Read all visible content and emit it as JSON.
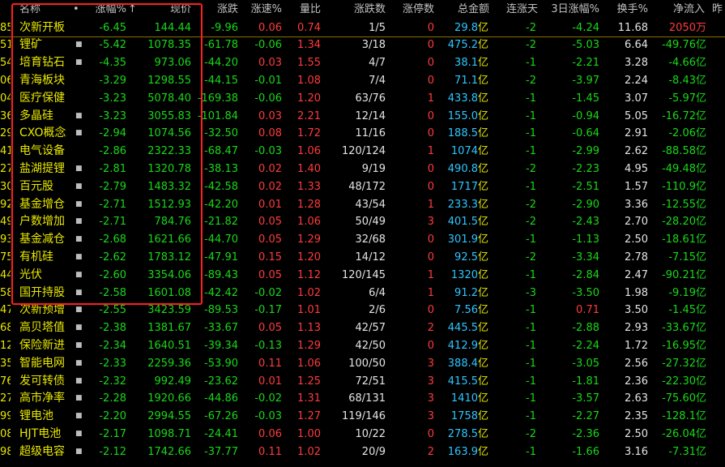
{
  "headers": {
    "name": "名称",
    "dot": "•",
    "change_pct": "涨幅%",
    "sort_arrow": "↑",
    "price": "现价",
    "change": "涨跌",
    "speed": "涨速%",
    "volume_ratio": "量比",
    "rise_fall": "涨跌数",
    "limit_up": "涨停数",
    "amount": "总金额",
    "streak": "连涨天",
    "three_day": "3日涨幅%",
    "turnover": "换手%",
    "net_inflow": "净流入",
    "extra": "昨"
  },
  "rows": [
    {
      "code": "85",
      "name": "次新开板",
      "mark": "",
      "change_pct": "-6.45",
      "price": "144.44",
      "change": "-9.96",
      "speed": "0.06",
      "volume_ratio": "0.74",
      "rise_fall": "1/5",
      "limit_up": "0",
      "amount": "29.8",
      "streak": "-2",
      "three_day": "-4.24",
      "turnover": "11.68",
      "net_inflow": "2050万"
    },
    {
      "code": "51",
      "name": "锂矿",
      "mark": "■",
      "change_pct": "-5.42",
      "price": "1078.35",
      "change": "-61.78",
      "speed": "-0.06",
      "volume_ratio": "1.34",
      "rise_fall": "3/18",
      "limit_up": "0",
      "amount": "475.2",
      "streak": "-2",
      "three_day": "-5.03",
      "turnover": "6.64",
      "net_inflow": "-49.76亿"
    },
    {
      "code": "54",
      "name": "培育钻石",
      "mark": "■",
      "change_pct": "-4.35",
      "price": "973.06",
      "change": "-44.20",
      "speed": "0.03",
      "volume_ratio": "1.55",
      "rise_fall": "4/7",
      "limit_up": "0",
      "amount": "38.1",
      "streak": "-1",
      "three_day": "-2.21",
      "turnover": "3.28",
      "net_inflow": "-4.66亿"
    },
    {
      "code": "06",
      "name": "青海板块",
      "mark": "",
      "change_pct": "-3.29",
      "price": "1298.55",
      "change": "-44.15",
      "speed": "-0.01",
      "volume_ratio": "1.08",
      "rise_fall": "7/4",
      "limit_up": "0",
      "amount": "71.1",
      "streak": "-2",
      "three_day": "-3.97",
      "turnover": "2.24",
      "net_inflow": "-8.43亿"
    },
    {
      "code": "04",
      "name": "医疗保健",
      "mark": "",
      "change_pct": "-3.23",
      "price": "5078.40",
      "change": "-169.38",
      "speed": "-0.06",
      "volume_ratio": "1.20",
      "rise_fall": "63/76",
      "limit_up": "1",
      "amount": "433.8",
      "streak": "-1",
      "three_day": "-1.45",
      "turnover": "3.07",
      "net_inflow": "-5.97亿"
    },
    {
      "code": "36",
      "name": "多晶硅",
      "mark": "■",
      "change_pct": "-3.23",
      "price": "3055.83",
      "change": "-101.84",
      "speed": "0.03",
      "volume_ratio": "2.21",
      "rise_fall": "12/14",
      "limit_up": "0",
      "amount": "155.0",
      "streak": "-1",
      "three_day": "-0.94",
      "turnover": "5.05",
      "net_inflow": "-16.72亿"
    },
    {
      "code": "29",
      "name": "CXO概念",
      "mark": "■",
      "change_pct": "-2.94",
      "price": "1074.56",
      "change": "-32.50",
      "speed": "0.08",
      "volume_ratio": "1.72",
      "rise_fall": "11/16",
      "limit_up": "0",
      "amount": "188.5",
      "streak": "-1",
      "three_day": "-0.64",
      "turnover": "2.91",
      "net_inflow": "-2.06亿"
    },
    {
      "code": "41",
      "name": "电气设备",
      "mark": "",
      "change_pct": "-2.86",
      "price": "2322.33",
      "change": "-68.47",
      "speed": "-0.03",
      "volume_ratio": "1.06",
      "rise_fall": "120/124",
      "limit_up": "1",
      "amount": "1074",
      "streak": "-1",
      "three_day": "-2.99",
      "turnover": "2.62",
      "net_inflow": "-88.58亿"
    },
    {
      "code": "27",
      "name": "盐湖提锂",
      "mark": "■",
      "change_pct": "-2.81",
      "price": "1320.78",
      "change": "-38.13",
      "speed": "0.02",
      "volume_ratio": "1.40",
      "rise_fall": "9/19",
      "limit_up": "0",
      "amount": "490.8",
      "streak": "-2",
      "three_day": "-2.23",
      "turnover": "4.95",
      "net_inflow": "-49.48亿"
    },
    {
      "code": "30",
      "name": "百元股",
      "mark": "■",
      "change_pct": "-2.79",
      "price": "1483.32",
      "change": "-42.58",
      "speed": "0.02",
      "volume_ratio": "1.33",
      "rise_fall": "48/172",
      "limit_up": "0",
      "amount": "1717",
      "streak": "-1",
      "three_day": "-2.51",
      "turnover": "1.57",
      "net_inflow": "-110.9亿"
    },
    {
      "code": "92",
      "name": "基金增仓",
      "mark": "■",
      "change_pct": "-2.71",
      "price": "1512.93",
      "change": "-42.20",
      "speed": "0.01",
      "volume_ratio": "1.28",
      "rise_fall": "43/54",
      "limit_up": "1",
      "amount": "233.3",
      "streak": "-2",
      "three_day": "-2.90",
      "turnover": "3.36",
      "net_inflow": "-12.55亿"
    },
    {
      "code": "49",
      "name": "户数增加",
      "mark": "■",
      "change_pct": "-2.71",
      "price": "784.76",
      "change": "-21.82",
      "speed": "0.05",
      "volume_ratio": "1.06",
      "rise_fall": "50/49",
      "limit_up": "3",
      "amount": "401.5",
      "streak": "-2",
      "three_day": "-2.43",
      "turnover": "2.70",
      "net_inflow": "-28.20亿"
    },
    {
      "code": "93",
      "name": "基金减仓",
      "mark": "■",
      "change_pct": "-2.68",
      "price": "1621.66",
      "change": "-44.70",
      "speed": "0.05",
      "volume_ratio": "1.29",
      "rise_fall": "32/68",
      "limit_up": "0",
      "amount": "301.9",
      "streak": "-1",
      "three_day": "-1.13",
      "turnover": "2.50",
      "net_inflow": "-18.61亿"
    },
    {
      "code": "75",
      "name": "有机硅",
      "mark": "■",
      "change_pct": "-2.62",
      "price": "1783.12",
      "change": "-47.91",
      "speed": "0.15",
      "volume_ratio": "1.20",
      "rise_fall": "14/12",
      "limit_up": "0",
      "amount": "92.5",
      "streak": "-2",
      "three_day": "-3.34",
      "turnover": "2.78",
      "net_inflow": "-7.15亿"
    },
    {
      "code": "44",
      "name": "光伏",
      "mark": "■",
      "change_pct": "-2.60",
      "price": "3354.06",
      "change": "-89.43",
      "speed": "0.05",
      "volume_ratio": "1.12",
      "rise_fall": "120/145",
      "limit_up": "1",
      "amount": "1320",
      "streak": "-1",
      "three_day": "-2.84",
      "turnover": "2.47",
      "net_inflow": "-90.21亿"
    },
    {
      "code": "58",
      "name": "国开持股",
      "mark": "■",
      "change_pct": "-2.58",
      "price": "1601.08",
      "change": "-42.42",
      "speed": "-0.02",
      "volume_ratio": "1.02",
      "rise_fall": "6/4",
      "limit_up": "1",
      "amount": "91.2",
      "streak": "-3",
      "three_day": "-3.50",
      "turnover": "1.98",
      "net_inflow": "-9.19亿"
    },
    {
      "code": "47",
      "name": "次新预增",
      "mark": "■",
      "change_pct": "-2.55",
      "price": "3423.59",
      "change": "-89.53",
      "speed": "-0.17",
      "volume_ratio": "1.01",
      "rise_fall": "2/6",
      "limit_up": "0",
      "amount": "7.56",
      "streak": "-1",
      "three_day": "0.71",
      "turnover": "3.50",
      "net_inflow": "-1.45亿"
    },
    {
      "code": "68",
      "name": "高贝塔值",
      "mark": "■",
      "change_pct": "-2.38",
      "price": "1381.67",
      "change": "-33.67",
      "speed": "0.05",
      "volume_ratio": "1.13",
      "rise_fall": "42/57",
      "limit_up": "2",
      "amount": "445.5",
      "streak": "-1",
      "three_day": "-2.88",
      "turnover": "2.93",
      "net_inflow": "-33.67亿"
    },
    {
      "code": "12",
      "name": "保险新进",
      "mark": "■",
      "change_pct": "-2.34",
      "price": "1640.51",
      "change": "-39.34",
      "speed": "-0.13",
      "volume_ratio": "1.29",
      "rise_fall": "42/50",
      "limit_up": "0",
      "amount": "412.9",
      "streak": "-1",
      "three_day": "-2.24",
      "turnover": "1.72",
      "net_inflow": "-16.95亿"
    },
    {
      "code": "35",
      "name": "智能电网",
      "mark": "■",
      "change_pct": "-2.33",
      "price": "2259.36",
      "change": "-53.90",
      "speed": "0.11",
      "volume_ratio": "1.06",
      "rise_fall": "100/50",
      "limit_up": "3",
      "amount": "388.4",
      "streak": "-1",
      "three_day": "-3.05",
      "turnover": "2.56",
      "net_inflow": "-27.32亿"
    },
    {
      "code": "76",
      "name": "发可转债",
      "mark": "■",
      "change_pct": "-2.32",
      "price": "992.49",
      "change": "-23.62",
      "speed": "0.01",
      "volume_ratio": "1.25",
      "rise_fall": "72/51",
      "limit_up": "3",
      "amount": "415.5",
      "streak": "-1",
      "three_day": "-1.81",
      "turnover": "2.36",
      "net_inflow": "-22.30亿"
    },
    {
      "code": "27",
      "name": "高市净率",
      "mark": "■",
      "change_pct": "-2.28",
      "price": "1920.66",
      "change": "-44.86",
      "speed": "-0.02",
      "volume_ratio": "1.31",
      "rise_fall": "68/131",
      "limit_up": "3",
      "amount": "1410",
      "streak": "-1",
      "three_day": "-3.57",
      "turnover": "2.63",
      "net_inflow": "-75.60亿"
    },
    {
      "code": "99",
      "name": "锂电池",
      "mark": "■",
      "change_pct": "-2.20",
      "price": "2994.55",
      "change": "-67.26",
      "speed": "-0.03",
      "volume_ratio": "1.27",
      "rise_fall": "119/146",
      "limit_up": "3",
      "amount": "1758",
      "streak": "-1",
      "three_day": "-2.27",
      "turnover": "2.35",
      "net_inflow": "-128.1亿"
    },
    {
      "code": "08",
      "name": "HJT电池",
      "mark": "■",
      "change_pct": "-2.17",
      "price": "1098.71",
      "change": "-24.41",
      "speed": "0.06",
      "volume_ratio": "1.00",
      "rise_fall": "10/22",
      "limit_up": "0",
      "amount": "278.5",
      "streak": "-2",
      "three_day": "-2.36",
      "turnover": "2.50",
      "net_inflow": "-26.04亿"
    },
    {
      "code": "98",
      "name": "超级电容",
      "mark": "■",
      "change_pct": "-2.12",
      "price": "1742.66",
      "change": "-37.77",
      "speed": "0.11",
      "volume_ratio": "1.02",
      "rise_fall": "20/9",
      "limit_up": "2",
      "amount": "163.9",
      "streak": "-1",
      "three_day": "-1.66",
      "turnover": "3.16",
      "net_inflow": "-7.31亿"
    }
  ],
  "amount_unit": "亿",
  "colors": {
    "up": "#ff3b3b",
    "down": "#18d818",
    "name": "#e8e800",
    "amount": "#2ec7ff",
    "box": "#ff1e1e",
    "separator": "#8a6d00"
  }
}
